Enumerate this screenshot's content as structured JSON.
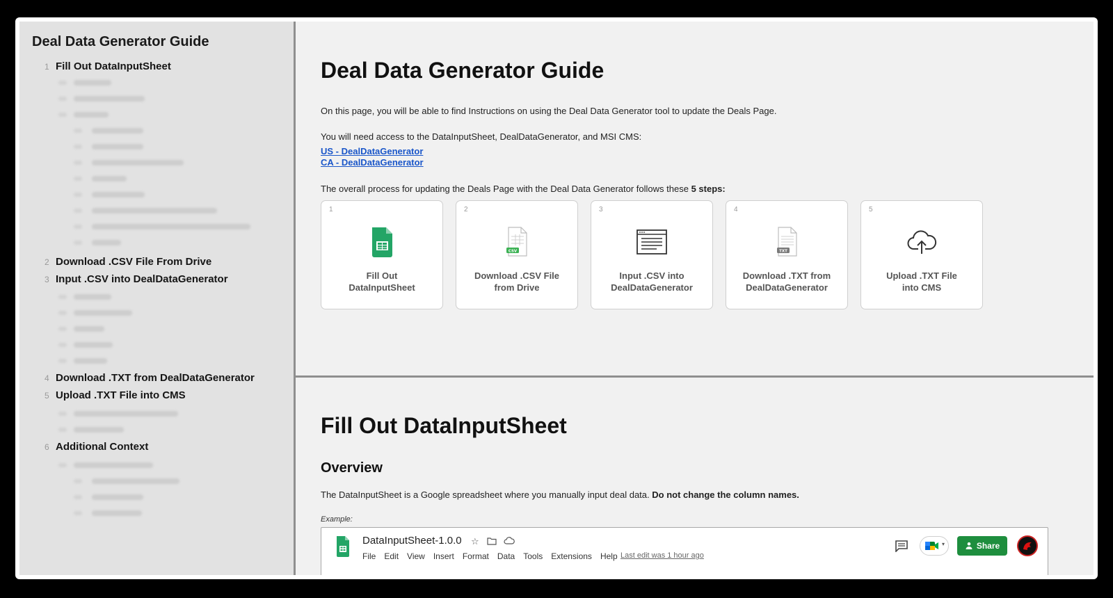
{
  "sidebar": {
    "title": "Deal Data Generator Guide",
    "items": [
      {
        "num": "1",
        "label": "Fill Out DataInputSheet"
      },
      {
        "num": "2",
        "label": "Download .CSV File From Drive"
      },
      {
        "num": "3",
        "label": "Input .CSV into DealDataGenerator"
      },
      {
        "num": "4",
        "label": "Download .TXT from DealDataGenerator"
      },
      {
        "num": "5",
        "label": "Upload .TXT File into CMS"
      },
      {
        "num": "6",
        "label": "Additional Context"
      }
    ]
  },
  "main": {
    "title": "Deal Data Generator Guide",
    "intro": "On this page, you will be able to find Instructions on using the Deal Data Generator tool to update the Deals Page.",
    "access_text": "You will need access to the DataInputSheet, DealDataGenerator, and MSI CMS:",
    "links": [
      "US - DealDataGenerator",
      "CA - DealDataGenerator"
    ],
    "process_text": "The overall process for updating the Deals Page with the Deal Data Generator follows these ",
    "process_bold": "5 steps:",
    "steps": [
      {
        "num": "1",
        "line1": "Fill Out",
        "line2": "DataInputSheet",
        "icon": "google-sheets-icon"
      },
      {
        "num": "2",
        "line1": "Download .CSV File",
        "line2": "from Drive",
        "icon": "csv-file-icon"
      },
      {
        "num": "3",
        "line1": "Input .CSV into",
        "line2": "DealDataGenerator",
        "icon": "browser-window-icon"
      },
      {
        "num": "4",
        "line1": "Download .TXT from",
        "line2": "DealDataGenerator",
        "icon": "txt-file-icon"
      },
      {
        "num": "5",
        "line1": "Upload .TXT File",
        "line2": "into CMS",
        "icon": "cloud-upload-icon"
      }
    ],
    "section2_title": "Fill Out DataInputSheet",
    "overview_heading": "Overview",
    "overview_text": "The DataInputSheet is a Google spreadsheet where you manually input deal data. ",
    "overview_bold": "Do not change the column names.",
    "example_label": "Example:"
  },
  "sheet": {
    "title": "DataInputSheet-1.0.0",
    "menu": [
      "File",
      "Edit",
      "View",
      "Insert",
      "Format",
      "Data",
      "Tools",
      "Extensions",
      "Help"
    ],
    "last_edit": "Last edit was 1 hour ago",
    "share_label": "Share"
  }
}
